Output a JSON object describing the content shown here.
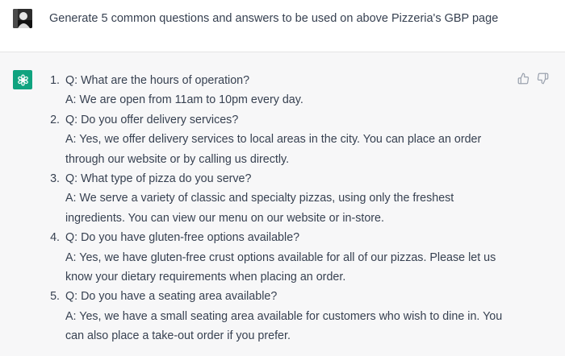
{
  "user_message": {
    "text": "Generate 5 common questions and answers to be used on above Pizzeria's GBP page"
  },
  "assistant": {
    "items": [
      {
        "number": "1.",
        "lines": [
          "Q: What are the hours of operation?",
          "A: We are open from 11am to 10pm every day."
        ]
      },
      {
        "number": "2.",
        "lines": [
          "Q: Do you offer delivery services?",
          "A: Yes, we offer delivery services to local areas in the city. You can place an order",
          "through our website or by calling us directly."
        ]
      },
      {
        "number": "3.",
        "lines": [
          "Q: What type of pizza do you serve?",
          "A: We serve a variety of classic and specialty pizzas, using only the freshest",
          "ingredients. You can view our menu on our website or in-store."
        ]
      },
      {
        "number": "4.",
        "lines": [
          "Q: Do you have gluten-free options available?",
          "A: Yes, we have gluten-free crust options available for all of our pizzas. Please let us",
          "know your dietary requirements when placing an order."
        ]
      },
      {
        "number": "5.",
        "lines": [
          "Q: Do you have a seating area available?",
          "A: Yes, we have a small seating area available for customers who wish to dine in. You",
          "can also place a take-out order if you prefer."
        ]
      }
    ],
    "icons": {
      "avatar": "openai-logo-icon",
      "feedback_up": "thumbs-up-icon",
      "feedback_down": "thumbs-down-icon"
    }
  },
  "colors": {
    "assistant_bg": "#f7f7f8",
    "brand_green": "#10a37f",
    "text": "#374151"
  }
}
